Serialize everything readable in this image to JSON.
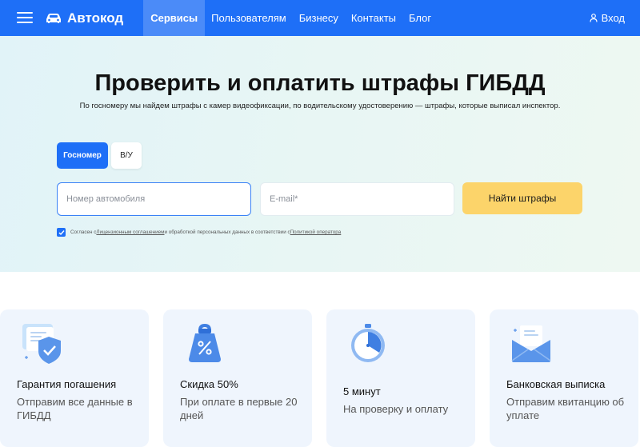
{
  "header": {
    "logo": "Автокод",
    "nav": [
      "Сервисы",
      "Пользователям",
      "Бизнесу",
      "Контакты",
      "Блог"
    ],
    "login": "Вход",
    "brand_color": "#1e6ff7"
  },
  "hero": {
    "title": "Проверить и оплатить штрафы ГИБДД",
    "subtitle": "По госномеру мы найдем штрафы с камер видеофиксации, по водительскому удостоверению — штрафы, которые выписал инспектор.",
    "tabs": [
      "Госномер",
      "В/У"
    ],
    "plate_placeholder": "Номер автомобиля",
    "email_placeholder": "E-mail*",
    "button": "Найти штрафы",
    "consent": {
      "prefix": "Согласен с ",
      "link1": "Лицензионным соглашением",
      "middle": " и обработкой персональных данных в соответствии с ",
      "link2": "Политикой оператора",
      "checked": true
    }
  },
  "cards": [
    {
      "icon": "shield-document-icon",
      "title": "Гарантия погашения",
      "text": "Отправим все данные в ГИБДД"
    },
    {
      "icon": "discount-weight-icon",
      "title": "Скидка 50%",
      "text": "При оплате в первые 20 дней"
    },
    {
      "icon": "stopwatch-icon",
      "title": "5 минут",
      "text": "На проверку и оплату"
    },
    {
      "icon": "envelope-icon",
      "title": "Банковская выписка",
      "text": "Отправим квитанцию об уплате"
    }
  ]
}
